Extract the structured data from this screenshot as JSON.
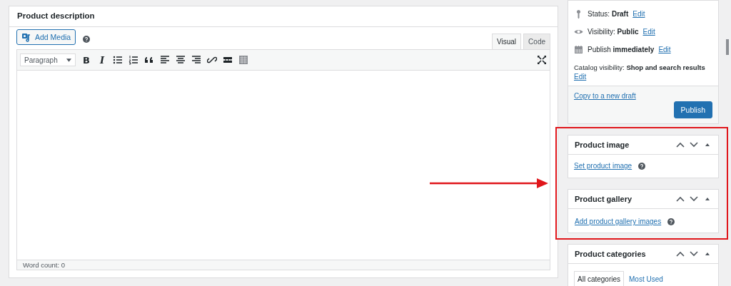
{
  "description_box": {
    "title": "Product description",
    "add_media": "Add Media",
    "editor_tabs": [
      {
        "label": "Visual",
        "selected": true
      },
      {
        "label": "Code",
        "selected": false
      }
    ],
    "toolbar": {
      "format": "Paragraph",
      "bold": "B",
      "italic": "I"
    },
    "word_count": "Word count: 0"
  },
  "publish_box": {
    "rows": [
      {
        "kind": "status",
        "text": "Status: **Draft**",
        "link": "Edit"
      },
      {
        "kind": "visibility",
        "text": "Visibility: **Public**",
        "link": "Edit"
      },
      {
        "kind": "schedule",
        "text": "Publish **immediately**",
        "link": "Edit"
      }
    ],
    "catalog_visibility": "Catalog visibility: **Shop and search results**",
    "catalog_link": "Edit",
    "copy_link": "Copy to a new draft",
    "publish_button": "Publish"
  },
  "product_image": {
    "title": "Product image",
    "link": "Set product image"
  },
  "product_gallery": {
    "title": "Product gallery",
    "link": "Add product gallery images"
  },
  "product_categories": {
    "title": "Product categories",
    "tabs": [
      {
        "label": "All categories",
        "selected": true
      },
      {
        "label": "Most Used",
        "selected": false
      }
    ]
  }
}
